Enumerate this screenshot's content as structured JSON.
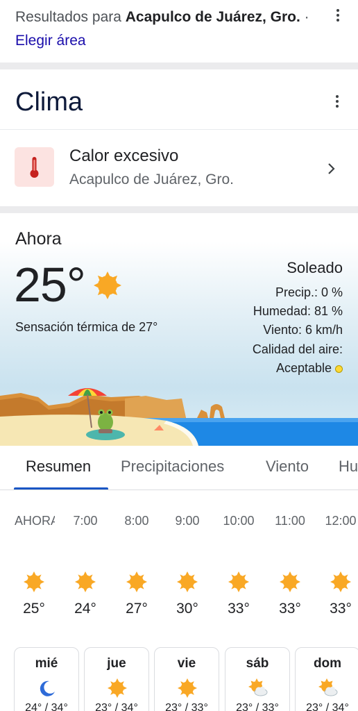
{
  "results": {
    "prefix": "Resultados para ",
    "location": "Acapulco de Juárez, Gro.",
    "separator": " · ",
    "choose_area": "Elegir área"
  },
  "card_title": "Clima",
  "alert": {
    "icon": "thermometer-icon",
    "title": "Calor excesivo",
    "subtitle": "Acapulco de Juárez, Gro."
  },
  "current": {
    "label": "Ahora",
    "temp": "25°",
    "feels_like": "Sensación térmica de 27°",
    "condition": "Soleado",
    "precip": "Precip.: 0 %",
    "humidity": "Humedad: 81 %",
    "wind": "Viento: 6 km/h",
    "air_quality_label": "Calidad del aire:",
    "air_quality_value": "Aceptable",
    "air_quality_color": "#fdd835"
  },
  "tabs": [
    {
      "label": "Resumen",
      "active": true
    },
    {
      "label": "Precipitaciones",
      "active": false
    },
    {
      "label": "Viento",
      "active": false
    },
    {
      "label": "Hu",
      "active": false
    }
  ],
  "hourly": [
    {
      "time": "AHORA",
      "temp": "25°",
      "icon": "sun-icon"
    },
    {
      "time": "7:00",
      "temp": "24°",
      "icon": "sun-icon"
    },
    {
      "time": "8:00",
      "temp": "27°",
      "icon": "sun-icon"
    },
    {
      "time": "9:00",
      "temp": "30°",
      "icon": "sun-icon"
    },
    {
      "time": "10:00",
      "temp": "33°",
      "icon": "sun-icon"
    },
    {
      "time": "11:00",
      "temp": "33°",
      "icon": "sun-icon"
    },
    {
      "time": "12:00",
      "temp": "33°",
      "icon": "sun-icon"
    }
  ],
  "daily": [
    {
      "day": "mié",
      "icon": "moon-icon",
      "range": "24° / 34°"
    },
    {
      "day": "jue",
      "icon": "sun-icon",
      "range": "23° / 34°"
    },
    {
      "day": "vie",
      "icon": "sun-icon",
      "range": "23° / 33°"
    },
    {
      "day": "sáb",
      "icon": "partly-sunny-icon",
      "range": "23° / 33°"
    },
    {
      "day": "dom",
      "icon": "partly-sunny-icon",
      "range": "23° / 34°"
    }
  ],
  "colors": {
    "sun": "#f9a825",
    "link": "#1a0dab",
    "tab_indicator": "#1a56c4",
    "alert_bg": "#fce3e1",
    "alert_icon": "#c5221f"
  }
}
